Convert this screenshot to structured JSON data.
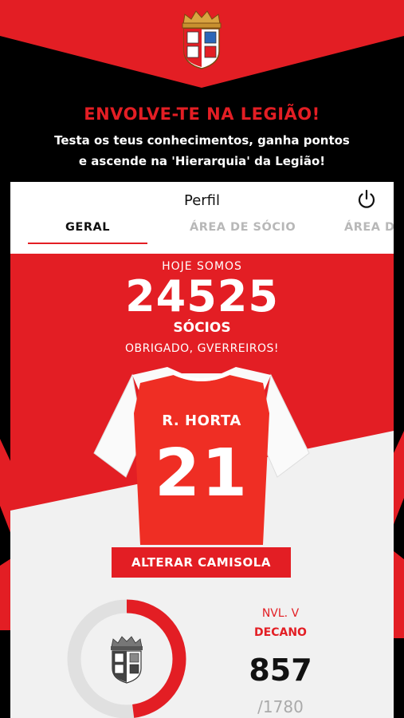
{
  "header": {
    "headline": "ENVOLVE-TE NA LEGIÃO!",
    "subline_1": "Testa os teus conhecimentos, ganha pontos",
    "subline_2": "e ascende na 'Hierarquia' da Legião!"
  },
  "profile": {
    "title": "Perfil",
    "tabs": [
      {
        "label": "GERAL",
        "active": true
      },
      {
        "label": "ÁREA DE SÓCIO",
        "active": false
      },
      {
        "label": "ÁREA D",
        "active": false
      }
    ]
  },
  "members": {
    "intro": "HOJE SOMOS",
    "count": "24525",
    "unit": "SÓCIOS",
    "thanks": "OBRIGADO, GVERREIROS!"
  },
  "shirt": {
    "name": "R. HORTA",
    "number": "21"
  },
  "change_shirt_button": "ALTERAR CAMISOLA",
  "level": {
    "level_label": "NVL. V",
    "rank": "DECANO",
    "points": "857",
    "points_total": "/1780",
    "progress_fraction": 0.48
  },
  "colors": {
    "brand_red": "#e31e24",
    "background": "#000000",
    "card_grey": "#f1f1f1"
  }
}
